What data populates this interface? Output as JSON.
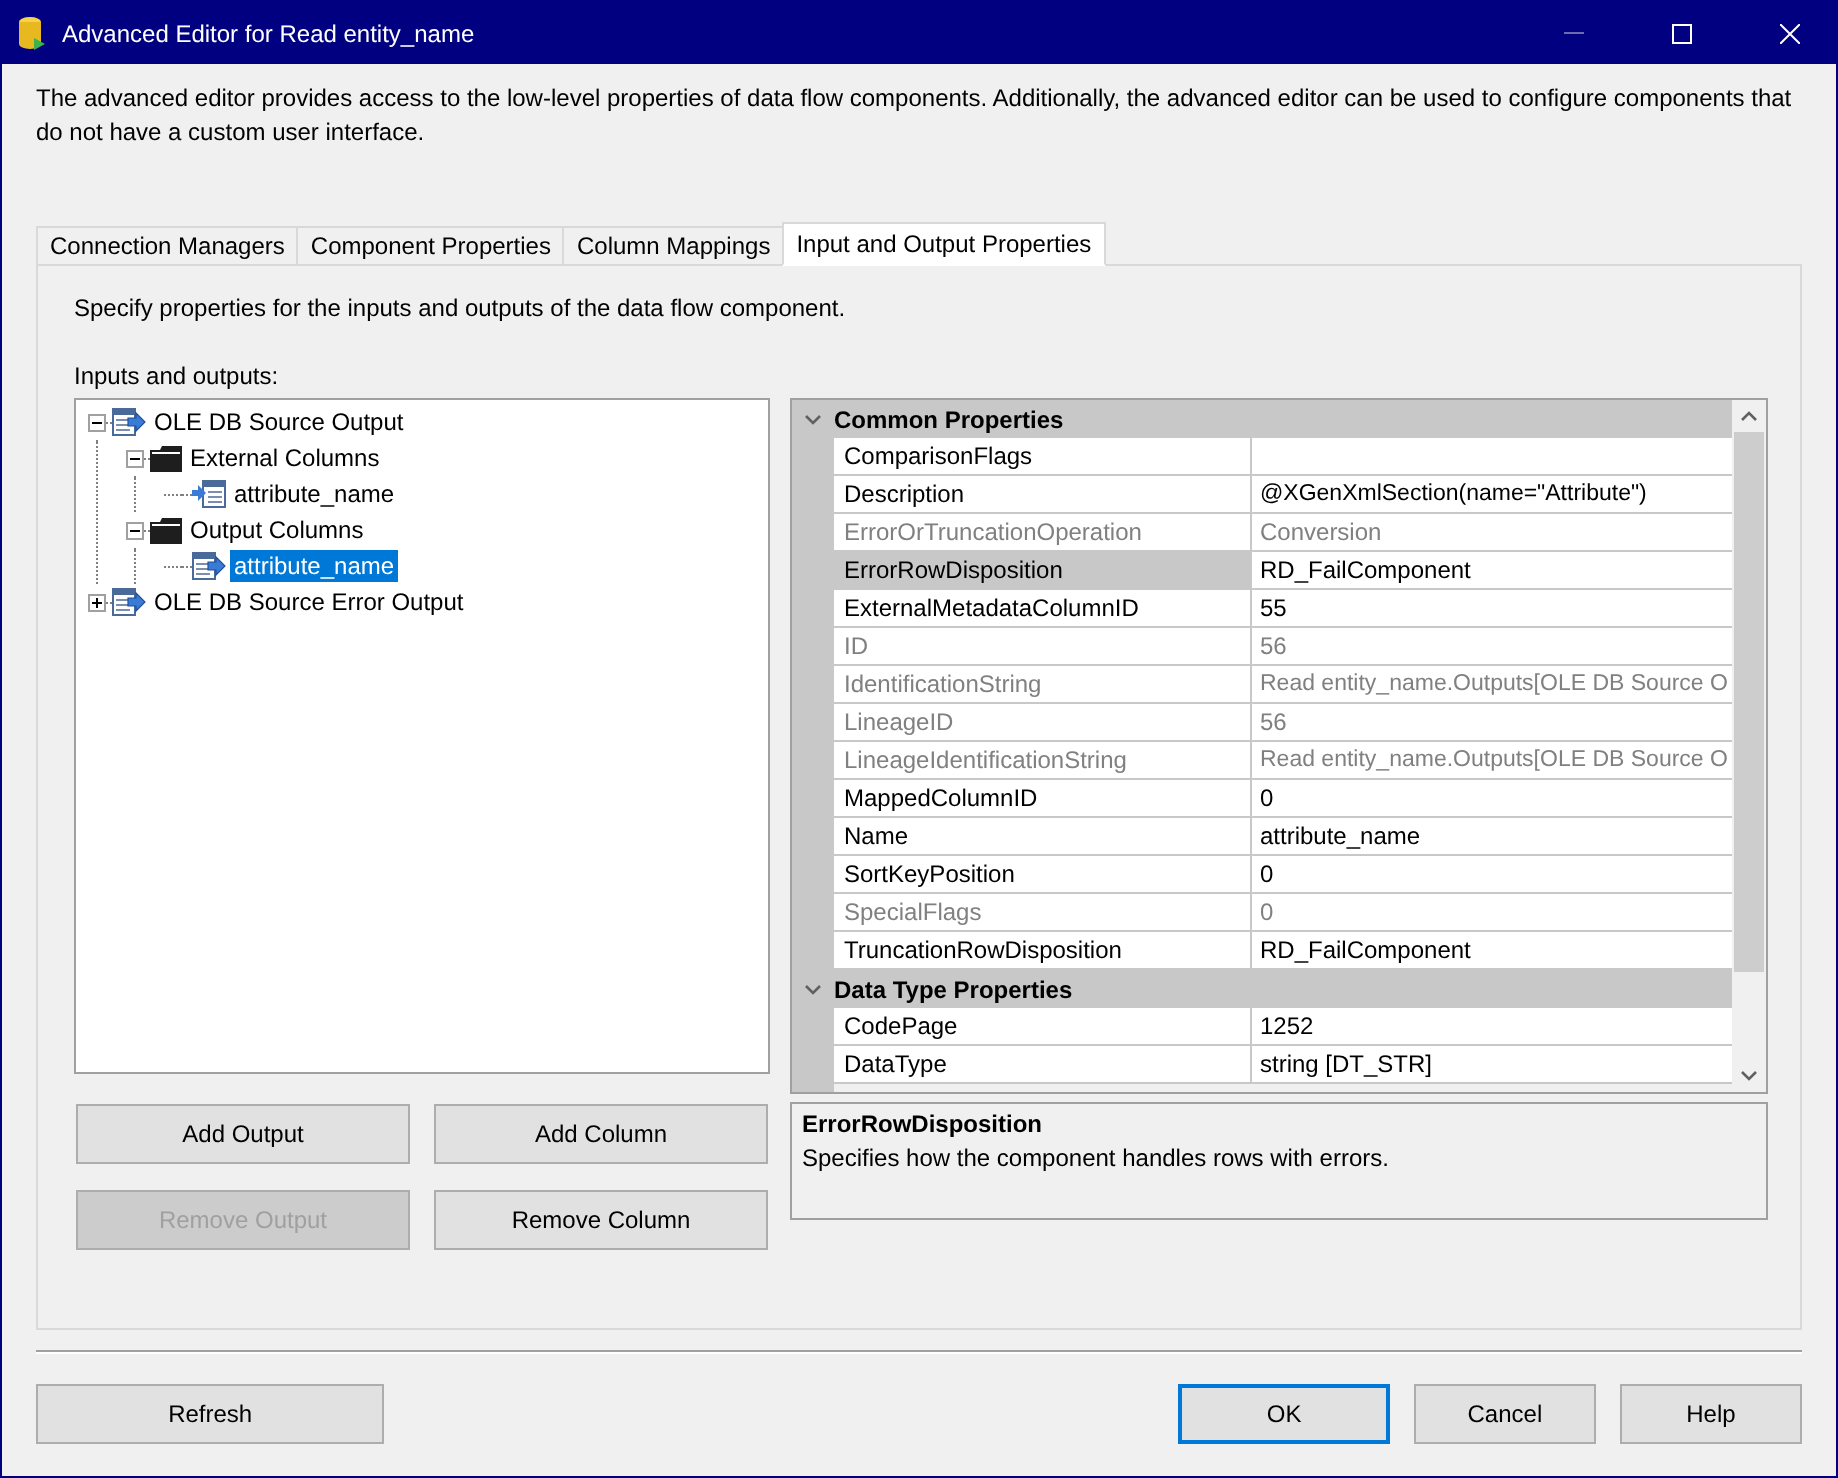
{
  "window": {
    "title": "Advanced Editor for Read entity_name"
  },
  "intro": "The advanced editor provides access to the low-level properties of data flow components. Additionally, the advanced editor can be used to configure components that do not have a custom user interface.",
  "tabs": [
    {
      "label": "Connection Managers",
      "selected": false
    },
    {
      "label": "Component Properties",
      "selected": false
    },
    {
      "label": "Column Mappings",
      "selected": false
    },
    {
      "label": "Input and Output Properties",
      "selected": true
    }
  ],
  "panel": {
    "instruction": "Specify properties for the inputs and outputs of the data flow component.",
    "tree_label": "Inputs and outputs:",
    "tree": [
      {
        "label": "OLE DB Source Output",
        "kind": "output",
        "expanded": true,
        "selected": false,
        "children": [
          {
            "label": "External Columns",
            "kind": "folder",
            "expanded": true,
            "selected": false,
            "children": [
              {
                "label": "attribute_name",
                "kind": "external-column",
                "selected": false
              }
            ]
          },
          {
            "label": "Output Columns",
            "kind": "folder",
            "expanded": true,
            "selected": false,
            "children": [
              {
                "label": "attribute_name",
                "kind": "output-column",
                "selected": true
              }
            ]
          }
        ]
      },
      {
        "label": "OLE DB Source Error Output",
        "kind": "output",
        "expanded": false,
        "selected": false
      }
    ],
    "buttons": [
      {
        "label": "Add Output",
        "disabled": false
      },
      {
        "label": "Add Column",
        "disabled": false
      },
      {
        "label": "Remove Output",
        "disabled": true
      },
      {
        "label": "Remove Column",
        "disabled": false
      }
    ],
    "property_grid": {
      "categories": [
        {
          "name": "Common Properties",
          "expanded": true,
          "rows": [
            {
              "name": "ComparisonFlags",
              "value": "",
              "readonly": false,
              "selected": false
            },
            {
              "name": "Description",
              "value": "@XGenXmlSection(name=\"Attribute\")",
              "readonly": false,
              "selected": false
            },
            {
              "name": "ErrorOrTruncationOperation",
              "value": "Conversion",
              "readonly": true,
              "selected": false
            },
            {
              "name": "ErrorRowDisposition",
              "value": "RD_FailComponent",
              "readonly": false,
              "selected": true
            },
            {
              "name": "ExternalMetadataColumnID",
              "value": "55",
              "readonly": false,
              "selected": false
            },
            {
              "name": "ID",
              "value": "56",
              "readonly": true,
              "selected": false
            },
            {
              "name": "IdentificationString",
              "value": "Read entity_name.Outputs[OLE DB Source O",
              "readonly": true,
              "selected": false
            },
            {
              "name": "LineageID",
              "value": "56",
              "readonly": true,
              "selected": false
            },
            {
              "name": "LineageIdentificationString",
              "value": "Read entity_name.Outputs[OLE DB Source O",
              "readonly": true,
              "selected": false
            },
            {
              "name": "MappedColumnID",
              "value": "0",
              "readonly": false,
              "selected": false
            },
            {
              "name": "Name",
              "value": "attribute_name",
              "readonly": false,
              "selected": false
            },
            {
              "name": "SortKeyPosition",
              "value": "0",
              "readonly": false,
              "selected": false
            },
            {
              "name": "SpecialFlags",
              "value": "0",
              "readonly": true,
              "selected": false
            },
            {
              "name": "TruncationRowDisposition",
              "value": "RD_FailComponent",
              "readonly": false,
              "selected": false
            }
          ]
        },
        {
          "name": "Data Type Properties",
          "expanded": true,
          "rows": [
            {
              "name": "CodePage",
              "value": "1252",
              "readonly": false,
              "selected": false
            },
            {
              "name": "DataType",
              "value": "string [DT_STR]",
              "readonly": false,
              "selected": false
            }
          ]
        }
      ]
    },
    "description": {
      "title": "ErrorRowDisposition",
      "text": "Specifies how the component handles rows with errors."
    }
  },
  "footer_buttons": [
    {
      "label": "Refresh",
      "default": false
    },
    {
      "label": "OK",
      "default": true
    },
    {
      "label": "Cancel",
      "default": false
    },
    {
      "label": "Help",
      "default": false
    }
  ]
}
